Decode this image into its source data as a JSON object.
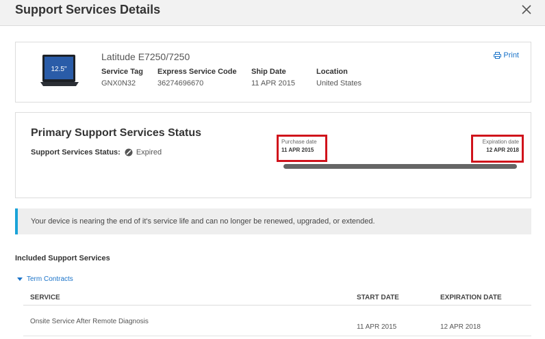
{
  "modal": {
    "title": "Support Services Details"
  },
  "device": {
    "model": "Latitude E7250/7250",
    "screen_badge": "12.5\"",
    "fields": [
      {
        "label": "Service Tag",
        "value": "GNX0N32"
      },
      {
        "label": "Express Service Code",
        "value": "36274696670"
      },
      {
        "label": "Ship Date",
        "value": "11 APR 2015"
      },
      {
        "label": "Location",
        "value": "United States"
      }
    ],
    "print_label": "Print"
  },
  "status": {
    "title": "Primary Support Services Status",
    "label": "Support Services Status:",
    "value": "Expired",
    "purchase_label": "Purchase date",
    "purchase_date": "11 APR 2015",
    "expiration_label": "Expiration date",
    "expiration_date": "12 APR 2018"
  },
  "alert": {
    "text": "Your device is nearing the end of it's service life and can no longer be renewed, upgraded, or extended."
  },
  "included": {
    "title": "Included Support Services",
    "term_link": "Term Contracts",
    "columns": [
      "SERVICE",
      "START DATE",
      "EXPIRATION DATE"
    ],
    "rows": [
      {
        "service": "Onsite Service After Remote Diagnosis",
        "start": "11 APR 2015",
        "expiration": "12 APR 2018"
      }
    ]
  },
  "colors": {
    "accent": "#1a73c9",
    "highlight": "#d0121b",
    "alert_border": "#1aa3d8"
  }
}
